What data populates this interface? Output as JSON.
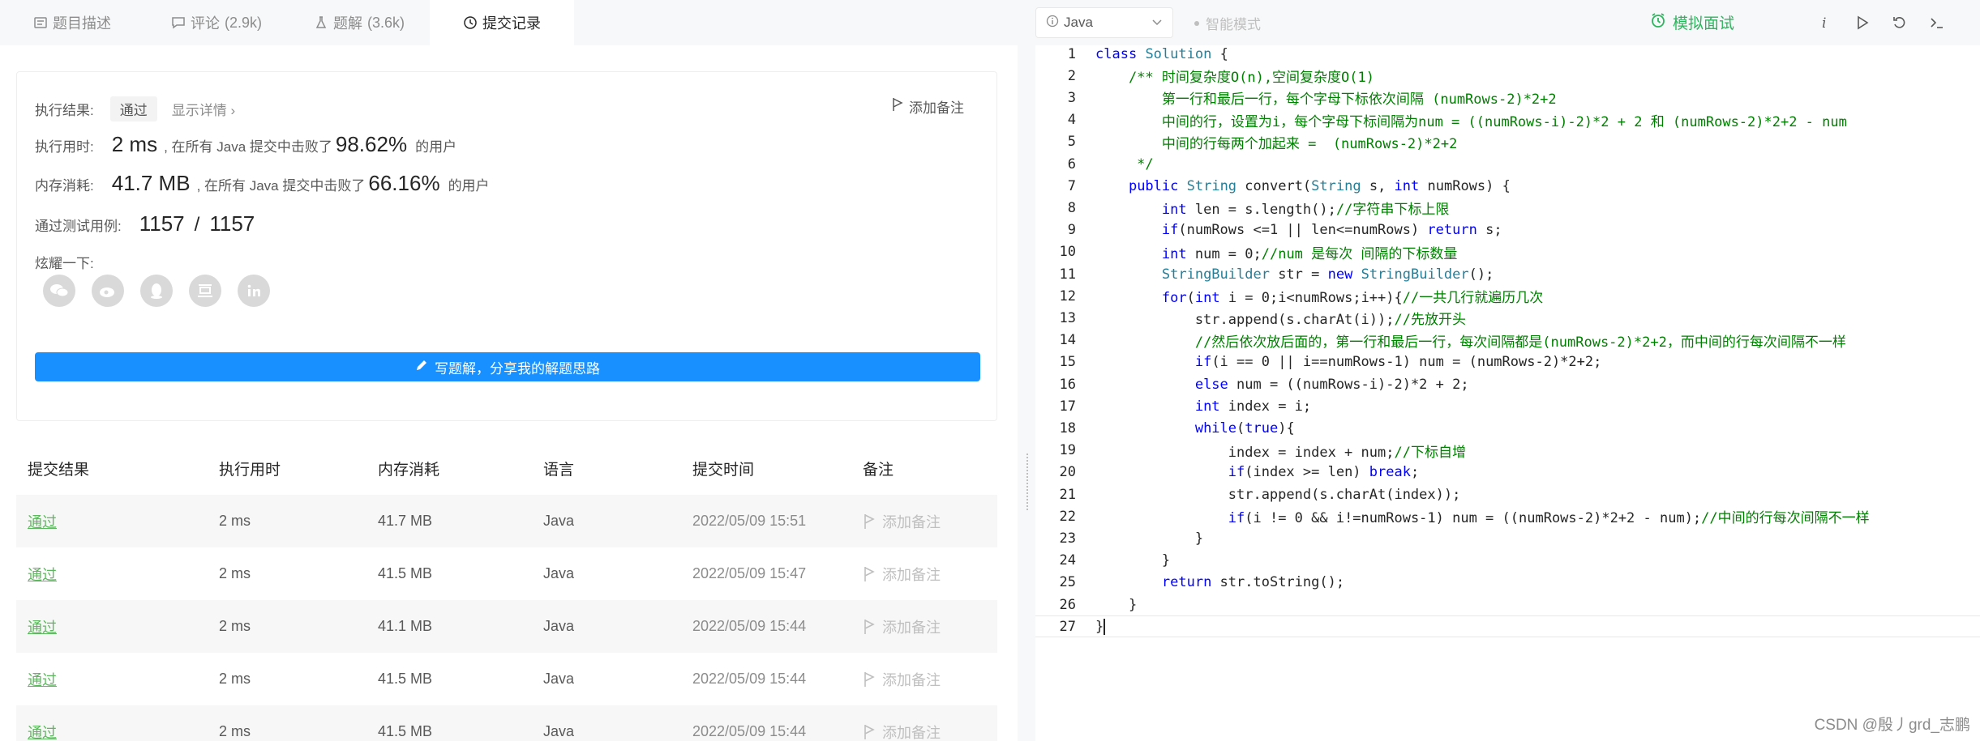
{
  "tabs": [
    {
      "label": "题目描述",
      "count": ""
    },
    {
      "label": "评论",
      "count": "(2.9k)"
    },
    {
      "label": "题解",
      "count": "(3.6k)"
    },
    {
      "label": "提交记录",
      "count": ""
    }
  ],
  "result": {
    "exec_result_label": "执行结果:",
    "status": "通过",
    "detail_link": "显示详情 ›",
    "add_note": "添加备注",
    "exec_time_label": "执行用时:",
    "exec_time": "2 ms",
    "exec_time_text": ", 在所有 Java 提交中击败了",
    "exec_time_pct": "98.62%",
    "users_suffix": "的用户",
    "memory_label": "内存消耗:",
    "memory": "41.7 MB",
    "memory_text": ", 在所有 Java 提交中击败了",
    "memory_pct": "66.16%",
    "tests_label": "通过测试用例:",
    "tests_passed": "1157",
    "tests_sep": "/",
    "tests_total": "1157",
    "share_label": "炫耀一下:",
    "share_icons": [
      "wechat-icon",
      "weibo-icon",
      "qq-icon",
      "douban-icon",
      "linkedin-icon"
    ],
    "write_button": "写题解，分享我的解题思路"
  },
  "table": {
    "headers": [
      "提交结果",
      "执行用时",
      "内存消耗",
      "语言",
      "提交时间",
      "备注"
    ],
    "rows": [
      {
        "status": "通过",
        "time": "2 ms",
        "memory": "41.7 MB",
        "lang": "Java",
        "submitted": "2022/05/09 15:51",
        "note": "添加备注"
      },
      {
        "status": "通过",
        "time": "2 ms",
        "memory": "41.5 MB",
        "lang": "Java",
        "submitted": "2022/05/09 15:47",
        "note": "添加备注"
      },
      {
        "status": "通过",
        "time": "2 ms",
        "memory": "41.1 MB",
        "lang": "Java",
        "submitted": "2022/05/09 15:44",
        "note": "添加备注"
      },
      {
        "status": "通过",
        "time": "2 ms",
        "memory": "41.5 MB",
        "lang": "Java",
        "submitted": "2022/05/09 15:44",
        "note": "添加备注"
      },
      {
        "status": "通过",
        "time": "2 ms",
        "memory": "41.5 MB",
        "lang": "Java",
        "submitted": "2022/05/09 15:44",
        "note": "添加备注"
      }
    ]
  },
  "toolbar": {
    "language": "Java",
    "smart_mode": "智能模式",
    "mock_interview": "模拟面试"
  },
  "code_lines": [
    "class Solution {",
    "    /** 时间复杂度O(n),空间复杂度O(1)",
    "        第一行和最后一行，每个字母下标依次间隔 (numRows-2)*2+2",
    "        中间的行，设置为i，每个字母下标间隔为num = ((numRows-i)-2)*2 + 2 和 (numRows-2)*2+2 - num",
    "        中间的行每两个加起来 =  (numRows-2)*2+2",
    "     */",
    "    public String convert(String s, int numRows) {",
    "        int len = s.length();//字符串下标上限",
    "        if(numRows <=1 || len<=numRows) return s;",
    "        int num = 0;//num 是每次 间隔的下标数量",
    "        StringBuilder str = new StringBuilder();",
    "        for(int i = 0;i<numRows;i++){//一共几行就遍历几次",
    "            str.append(s.charAt(i));//先放开头",
    "            //然后依次放后面的，第一行和最后一行，每次间隔都是(numRows-2)*2+2，而中间的行每次间隔不一样",
    "            if(i == 0 || i==numRows-1) num = (numRows-2)*2+2;",
    "            else num = ((numRows-i)-2)*2 + 2;",
    "            int index = i;",
    "            while(true){",
    "                index = index + num;//下标自增",
    "                if(index >= len) break;",
    "                str.append(s.charAt(index));",
    "                if(i != 0 && i!=numRows-1) num = ((numRows-2)*2+2 - num);//中间的行每次间隔不一样",
    "            }",
    "        }",
    "        return str.toString();",
    "    }",
    "}"
  ],
  "line_numbers": [
    "1",
    "2",
    "3",
    "4",
    "5",
    "6",
    "7",
    "8",
    "9",
    "10",
    "11",
    "12",
    "13",
    "14",
    "15",
    "16",
    "17",
    "18",
    "19",
    "20",
    "21",
    "22",
    "23",
    "24",
    "25",
    "26",
    "27"
  ],
  "watermark": "CSDN @殷丿grd_志鹏",
  "colors": {
    "keyword": "#0000ff",
    "type": "#267f99",
    "comment": "#008000",
    "pass": "#5cb85c",
    "primary": "#1890ff",
    "mock": "#2db55d"
  }
}
